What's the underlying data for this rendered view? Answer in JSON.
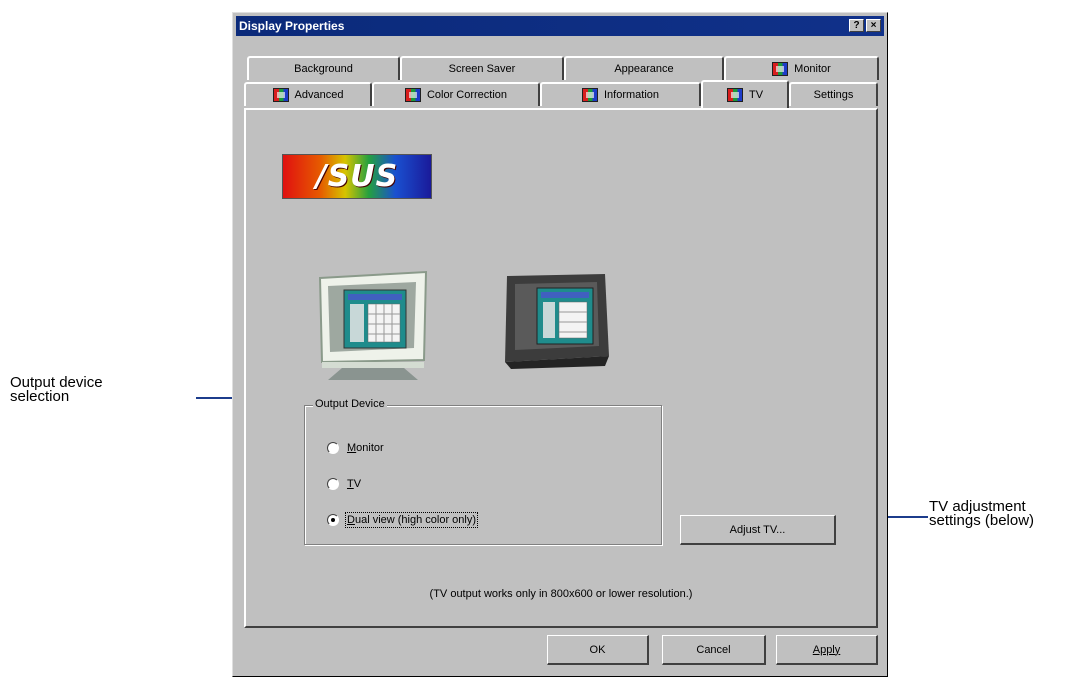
{
  "annotations": {
    "left": [
      "Output device",
      "selection"
    ],
    "right": [
      "TV adjustment",
      "settings (below)"
    ],
    "line_color": "#1c3c8c"
  },
  "window": {
    "title": "Display Properties",
    "help_button": "?",
    "close_button": "×"
  },
  "tabs": {
    "back_row": [
      {
        "label": "Background",
        "icon": false
      },
      {
        "label": "Screen Saver",
        "icon": false
      },
      {
        "label": "Appearance",
        "icon": false
      },
      {
        "label": "Monitor",
        "icon": true
      }
    ],
    "front_row": [
      {
        "label": "Advanced",
        "icon": true
      },
      {
        "label": "Color Correction",
        "icon": true
      },
      {
        "label": "Information",
        "icon": true
      },
      {
        "label": "TV",
        "icon": true,
        "active": true
      },
      {
        "label": "Settings",
        "icon": false
      }
    ]
  },
  "panel": {
    "logo_text": "/SUS",
    "output_device": {
      "label": "Output Device",
      "options": [
        {
          "label": "Monitor",
          "mnemonic": "M",
          "checked": false
        },
        {
          "label": "TV",
          "mnemonic": "T",
          "checked": false
        },
        {
          "label": "Dual view (high color only)",
          "mnemonic": "D",
          "checked": true
        }
      ]
    },
    "adjust_button": "Adjust TV...",
    "note": "(TV output works only in 800x600 or lower resolution.)"
  },
  "buttons": {
    "ok": "OK",
    "cancel": "Cancel",
    "apply": "Apply"
  }
}
